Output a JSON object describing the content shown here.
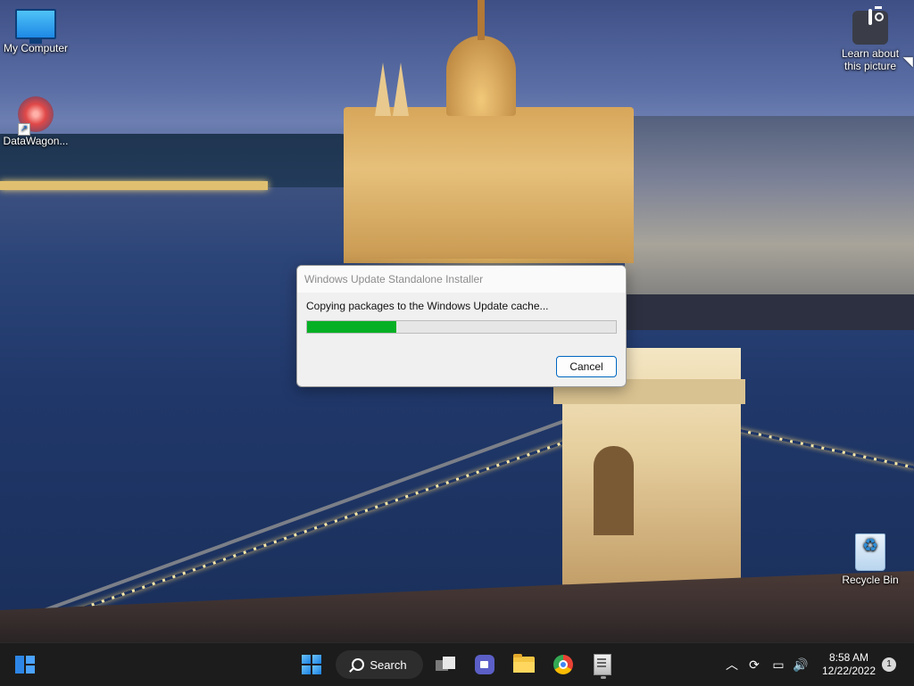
{
  "desktop": {
    "icons": [
      {
        "label": "My Computer"
      },
      {
        "label": "DataWagon..."
      },
      {
        "label": "Learn about this picture"
      },
      {
        "label": "Recycle Bin"
      }
    ]
  },
  "dialog": {
    "title": "Windows Update Standalone Installer",
    "message": "Copying packages to the Windows Update cache...",
    "progress_percent": 29,
    "cancel_label": "Cancel"
  },
  "taskbar": {
    "search_label": "Search",
    "pinned": [
      "widgets",
      "start",
      "search",
      "task-view",
      "teams-chat",
      "file-explorer",
      "chrome",
      "windows-update-installer"
    ],
    "tray": {
      "time": "8:58 AM",
      "date": "12/22/2022",
      "notification_count": "1"
    }
  },
  "colors": {
    "progress_fill": "#06b025",
    "accent": "#0067c0",
    "taskbar_bg": "#1c1c1c"
  }
}
